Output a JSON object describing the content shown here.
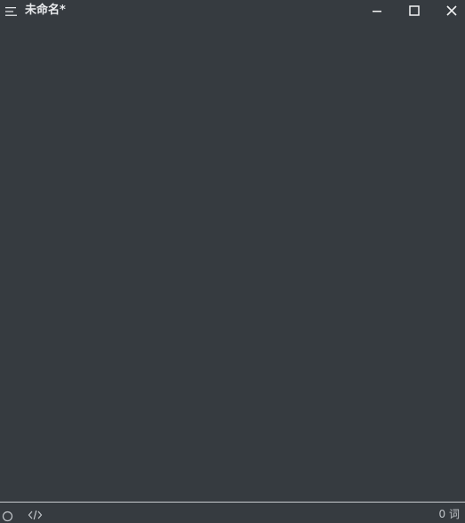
{
  "titlebar": {
    "title": "未命名*",
    "menu_icon": "hamburger-menu-icon",
    "minimize_icon": "minimize-icon",
    "maximize_icon": "maximize-icon",
    "close_icon": "close-icon"
  },
  "editor": {
    "content": ""
  },
  "footer": {
    "sidebar_icon": "circle-outline-icon",
    "source_icon": "code-icon",
    "word_count": "0 词"
  },
  "colors": {
    "background": "#363b40",
    "text": "#e9ebed",
    "divider": "#c9ccd0"
  }
}
